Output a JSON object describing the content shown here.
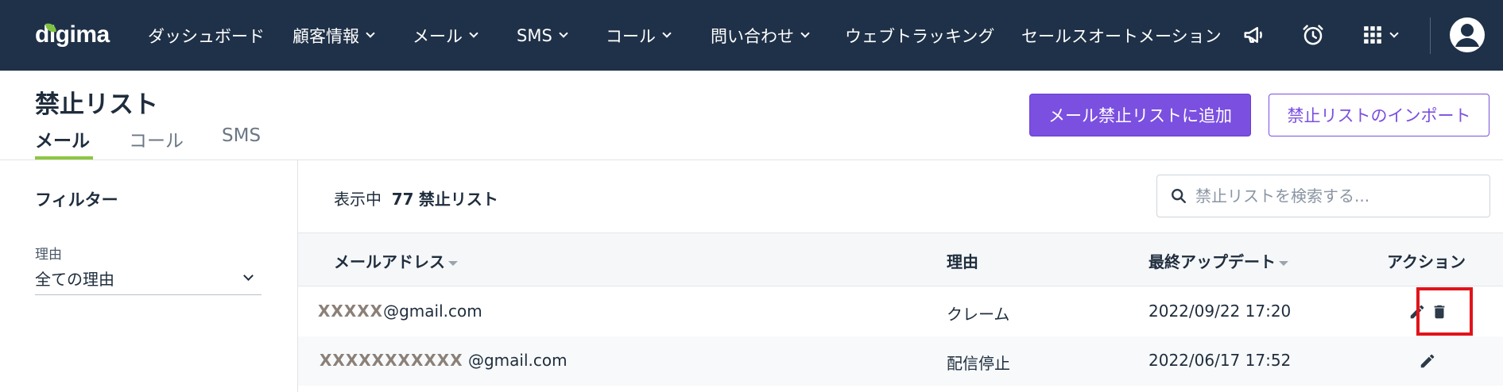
{
  "nav": {
    "logo": "digima",
    "items": [
      {
        "label": "ダッシュボード",
        "has_dropdown": false
      },
      {
        "label": "顧客情報",
        "has_dropdown": true
      },
      {
        "label": "メール",
        "has_dropdown": true
      },
      {
        "label": "SMS",
        "has_dropdown": true
      },
      {
        "label": "コール",
        "has_dropdown": true
      },
      {
        "label": "問い合わせ",
        "has_dropdown": true
      },
      {
        "label": "ウェブトラッキング",
        "has_dropdown": false
      },
      {
        "label": "セールスオートメーション",
        "has_dropdown": false
      }
    ],
    "icons": [
      "megaphone-icon",
      "alarm-clock-icon",
      "apps-grid-icon",
      "user-avatar-icon"
    ],
    "bg_color": "#1f3148"
  },
  "header": {
    "title": "禁止リスト",
    "tabs": [
      {
        "label": "メール",
        "active": true
      },
      {
        "label": "コール",
        "active": false
      },
      {
        "label": "SMS",
        "active": false
      }
    ],
    "primary_button": "メール禁止リストに追加",
    "secondary_button": "禁止リストのインポート",
    "accent_color": "#7b4fe0",
    "tab_accent": "#8dc63f"
  },
  "sidebar": {
    "title": "フィルター",
    "reason_label": "理由",
    "reason_value": "全ての理由"
  },
  "content": {
    "count_prefix": "表示中",
    "count": "77",
    "count_suffix": "禁止リスト",
    "search_placeholder": "禁止リストを検索する..."
  },
  "table": {
    "headers": {
      "email": "メールアドレス",
      "reason": "理由",
      "updated": "最終アップデート",
      "actions": "アクション"
    },
    "rows": [
      {
        "email_masked": "XXXXX",
        "email_domain": "@gmail.com",
        "reason": "クレーム",
        "updated": "2022/09/22 17:20"
      },
      {
        "email_masked": "XXXXXXXXXXX",
        "email_domain": " @gmail.com",
        "reason": "配信停止",
        "updated": "2022/06/17 17:52"
      }
    ]
  }
}
